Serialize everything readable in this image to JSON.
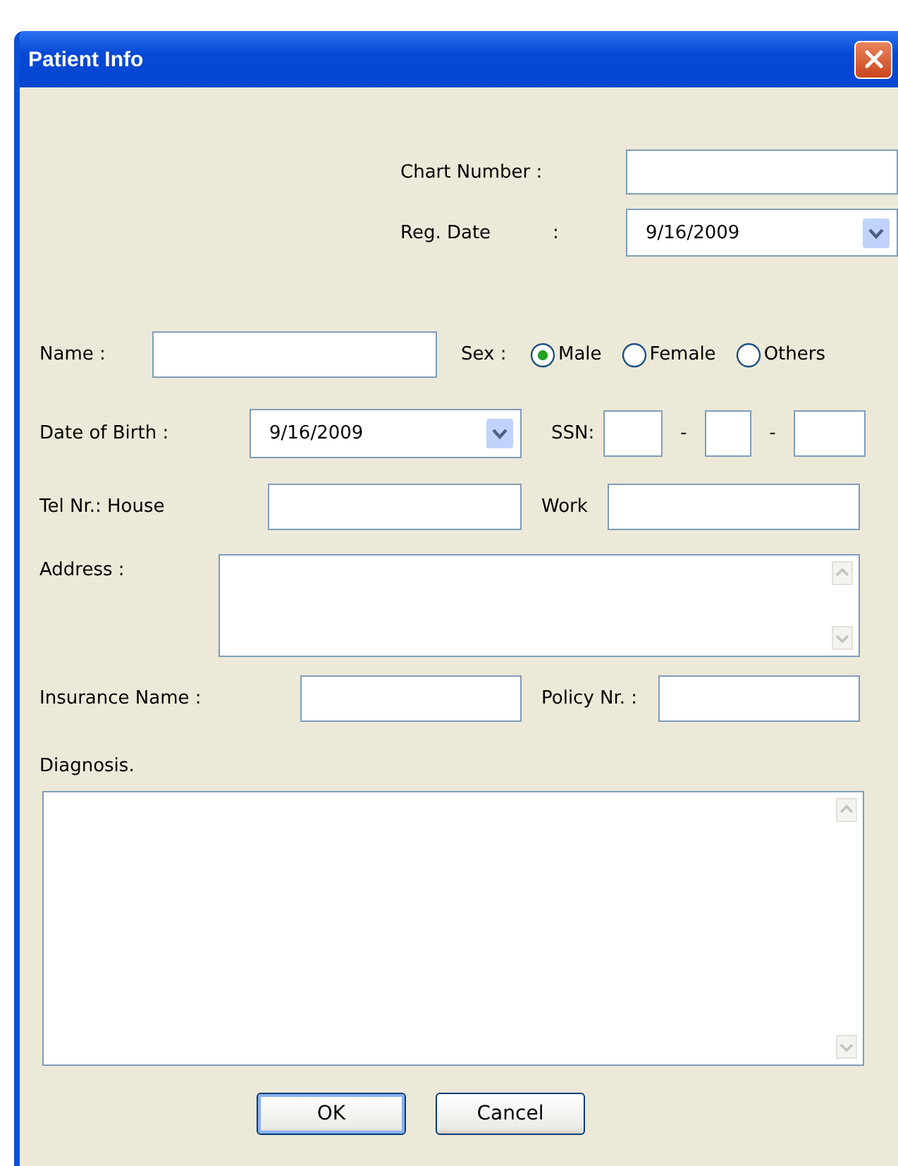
{
  "window": {
    "title": "Patient Info"
  },
  "chart_number": {
    "label": "Chart Number :"
  },
  "reg_date": {
    "label": "Reg. Date",
    "colon": ":",
    "value": "9/16/2009"
  },
  "name": {
    "label": "Name :"
  },
  "sex": {
    "label": "Sex :",
    "options": [
      {
        "label": "Male",
        "selected": true
      },
      {
        "label": "Female",
        "selected": false
      },
      {
        "label": "Others",
        "selected": false
      }
    ]
  },
  "date_of_birth": {
    "label": "Date of Birth :",
    "value": "9/16/2009"
  },
  "ssn": {
    "label": "SSN:",
    "separators": [
      "-",
      "-"
    ]
  },
  "tel_house": {
    "label": "Tel Nr.: House"
  },
  "tel_work": {
    "label": "Work"
  },
  "address": {
    "label": "Address :"
  },
  "insurance_name": {
    "label": "Insurance Name :"
  },
  "policy_nr": {
    "label": "Policy Nr. :"
  },
  "diagnosis": {
    "label": "Diagnosis."
  },
  "buttons": [
    {
      "label": "OK",
      "default": true
    },
    {
      "label": "Cancel",
      "default": false
    }
  ]
}
